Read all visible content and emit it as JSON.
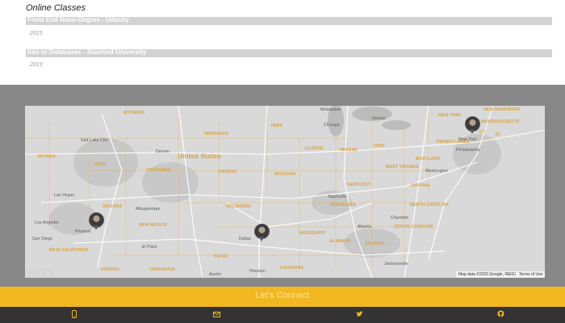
{
  "classes": {
    "title": "Online Classes",
    "items": [
      {
        "name": "Front End Nano-Degree - Udacity",
        "year": "2015"
      },
      {
        "name": "Into to Databases - Stanford University",
        "year": "2013"
      }
    ]
  },
  "map": {
    "labels": [
      {
        "id": "wyoming",
        "text": "WYOMING"
      },
      {
        "id": "nebraska",
        "text": "NEBRASKA"
      },
      {
        "id": "iowa",
        "text": "IOWA"
      },
      {
        "id": "milwaukee",
        "text": "Milwaukee"
      },
      {
        "id": "detroit",
        "text": "Detroit"
      },
      {
        "id": "new-york-state",
        "text": "NEW YORK"
      },
      {
        "id": "new-hampshire",
        "text": "NEW HAMPSHIRE"
      },
      {
        "id": "massachusetts",
        "text": "MASSACHUSETTS"
      },
      {
        "id": "ct",
        "text": "CT"
      },
      {
        "id": "ri",
        "text": "RI"
      },
      {
        "id": "chicago",
        "text": "Chicago"
      },
      {
        "id": "ohio",
        "text": "OHIO"
      },
      {
        "id": "pennsylvania",
        "text": "PENNSYLVANIA"
      },
      {
        "id": "new-york-city",
        "text": "New York"
      },
      {
        "id": "philadelphia",
        "text": "Philadelphia"
      },
      {
        "id": "nevada",
        "text": "NEVADA"
      },
      {
        "id": "salt-lake-city",
        "text": "Salt Lake City"
      },
      {
        "id": "utah",
        "text": "UTAH"
      },
      {
        "id": "denver",
        "text": "Denver"
      },
      {
        "id": "colorado",
        "text": "COLORADO"
      },
      {
        "id": "united-states",
        "text": "United States"
      },
      {
        "id": "kansas",
        "text": "KANSAS"
      },
      {
        "id": "illinois",
        "text": "ILLINOIS"
      },
      {
        "id": "indiana",
        "text": "INDIANA"
      },
      {
        "id": "missouri",
        "text": "MISSOURI"
      },
      {
        "id": "maryland",
        "text": "MARYLAND"
      },
      {
        "id": "west-virginia",
        "text": "WEST VIRGINIA"
      },
      {
        "id": "washington",
        "text": "Washington"
      },
      {
        "id": "virginia",
        "text": "VIRGINIA"
      },
      {
        "id": "kentucky",
        "text": "KENTUCKY"
      },
      {
        "id": "las-vegas",
        "text": "Las Vegas"
      },
      {
        "id": "arizona",
        "text": "ARIZONA"
      },
      {
        "id": "albuquerque",
        "text": "Albuquerque"
      },
      {
        "id": "new-mexico",
        "text": "NEW MEXICO"
      },
      {
        "id": "oklahoma",
        "text": "OKLAHOMA"
      },
      {
        "id": "nashville",
        "text": "Nashville"
      },
      {
        "id": "tennessee",
        "text": "TENNESSEE"
      },
      {
        "id": "north-carolina",
        "text": "NORTH CAROLINA"
      },
      {
        "id": "charlotte",
        "text": "Charlotte"
      },
      {
        "id": "south-carolina",
        "text": "SOUTH CAROLINA"
      },
      {
        "id": "atlanta",
        "text": "Atlanta"
      },
      {
        "id": "los-angeles",
        "text": "Los Angeles"
      },
      {
        "id": "phoenix",
        "text": "Phoenix"
      },
      {
        "id": "san-diego",
        "text": "San Diego"
      },
      {
        "id": "dallas",
        "text": "Dallas"
      },
      {
        "id": "mississippi",
        "text": "MISSISSIPPI"
      },
      {
        "id": "alabama",
        "text": "ALABAMA"
      },
      {
        "id": "georgia",
        "text": "GEORGIA"
      },
      {
        "id": "el-paso",
        "text": "El Paso"
      },
      {
        "id": "texas",
        "text": "TEXAS"
      },
      {
        "id": "baja-california",
        "text": "BAJA CALIFORNIA"
      },
      {
        "id": "sonora",
        "text": "SONORA"
      },
      {
        "id": "chihuahua",
        "text": "CHIHUAHUA"
      },
      {
        "id": "austin",
        "text": "Austin"
      },
      {
        "id": "houston",
        "text": "Houston"
      },
      {
        "id": "louisiana",
        "text": "LOUISIANA"
      },
      {
        "id": "jacksonville",
        "text": "Jacksonville"
      }
    ],
    "logo": "Google",
    "attribution": "Map data ©2015 Google, INEGI",
    "terms": "Terms of Use"
  },
  "connect": {
    "title": "Let's Connect"
  },
  "footer": {
    "icons": [
      "phone-icon",
      "mail-icon",
      "twitter-icon",
      "github-icon"
    ]
  },
  "colors": {
    "accent": "#f2b822",
    "footer_bg": "#333333",
    "map_frame": "#888888"
  }
}
